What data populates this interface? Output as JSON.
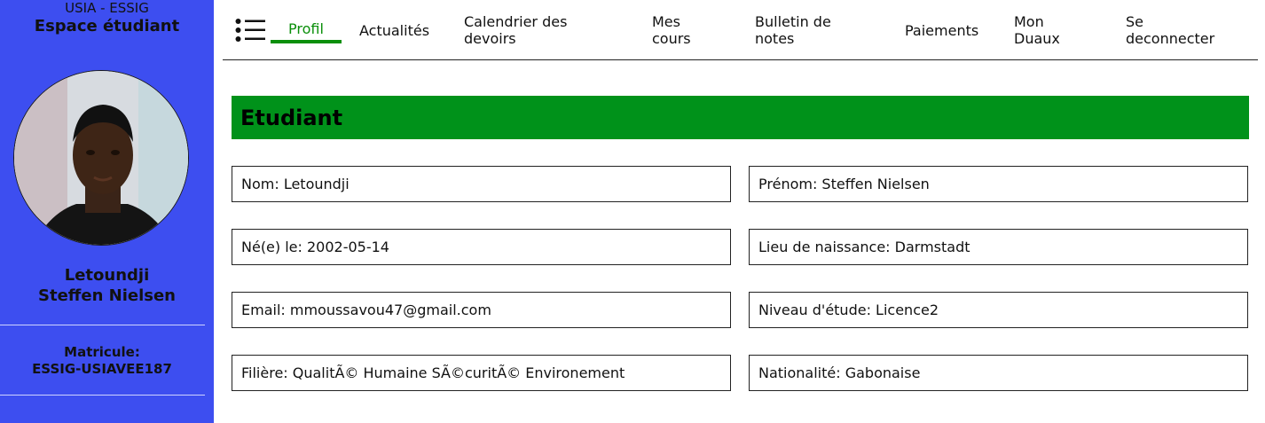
{
  "sidebar": {
    "school": "USIA - ESSIG",
    "title": "Espace étudiant",
    "name_line1": "Letoundji",
    "name_line2": "Steffen Nielsen",
    "matricule_label": "Matricule:",
    "matricule_value": "ESSIG-USIAVEE187",
    "avatar": "student-photo"
  },
  "nav": {
    "menu_icon": "list-menu-icon",
    "items": [
      {
        "line1": "Profil",
        "line2": ""
      },
      {
        "line1": "Actualités",
        "line2": ""
      },
      {
        "line1": "Calendrier des",
        "line2": "devoirs"
      },
      {
        "line1": "Mes",
        "line2": "cours"
      },
      {
        "line1": "Bulletin de",
        "line2": "notes"
      },
      {
        "line1": "Paiements",
        "line2": ""
      },
      {
        "line1": "Mon",
        "line2": "Duaux"
      },
      {
        "line1": "Se",
        "line2": "deconnecter"
      }
    ],
    "active": "Profil"
  },
  "main": {
    "heading": "Etudiant",
    "fields": {
      "nom": "Nom: Letoundji",
      "prenom": "Prénom: Steffen Nielsen",
      "naissance": "Né(e) le: 2002-05-14",
      "lieu": "Lieu de naissance: Darmstadt",
      "email": "Email: mmoussavou47@gmail.com",
      "niveau": "Niveau d'étude: Licence2",
      "filiere": "Filière: QualitÃ© Humaine SÃ©curitÃ© Environement",
      "nationalite": "Nationalité: Gabonaise"
    }
  },
  "colors": {
    "sidebar": "#3d4ef0",
    "accent_green": "#0a8f0a",
    "header_green": "#00921a"
  }
}
